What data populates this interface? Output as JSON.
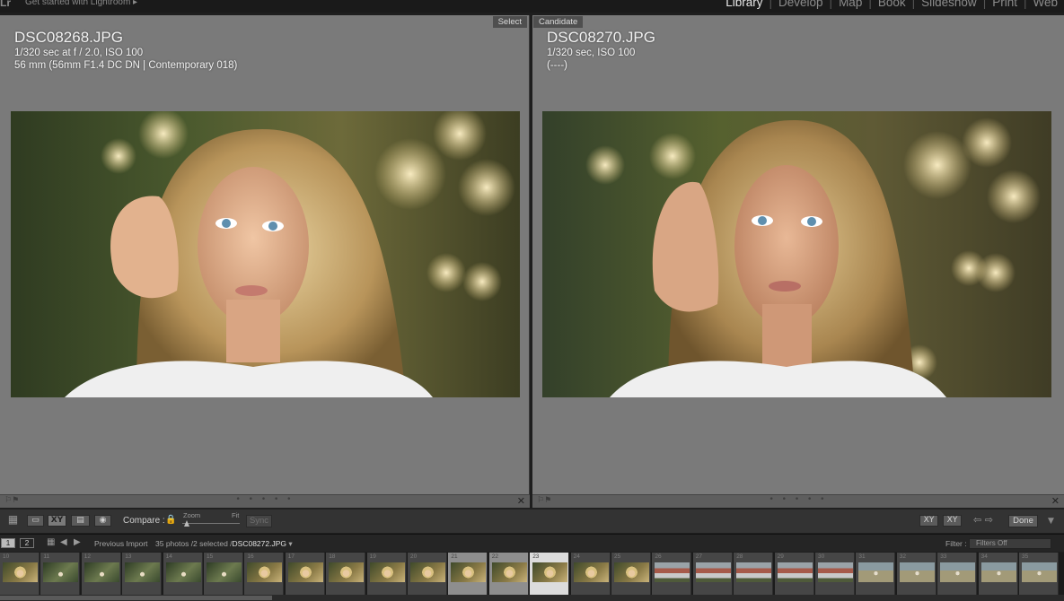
{
  "app": {
    "logo": "Lr",
    "get_started": "Get started with Lightroom  ▸",
    "modules": [
      "Library",
      "Develop",
      "Map",
      "Book",
      "Slideshow",
      "Print",
      "Web"
    ],
    "active_module": "Library"
  },
  "select_pane": {
    "tag": "Select",
    "filename": "DSC08268.JPG",
    "exposure": "1/320 sec at f / 2.0, ISO 100",
    "lens": "56 mm (56mm F1.4 DC DN | Contemporary 018)"
  },
  "candidate_pane": {
    "tag": "Candidate",
    "filename": "DSC08270.JPG",
    "exposure": "1/320 sec, ISO 100",
    "lens": " (----)"
  },
  "pane_footer": {
    "close": "✕",
    "dots": "• • • • •"
  },
  "toolbar": {
    "compare_label": "Compare :",
    "zoom_label": "Zoom",
    "fit_label": "Fit",
    "sync_label": "Sync",
    "done_label": "Done"
  },
  "filmstrip_nav": {
    "screen1": "1",
    "screen2": "2",
    "source": "Previous Import",
    "count": "35 photos /2 selected /",
    "current_file": "DSC08272.JPG",
    "filter_label": "Filter :",
    "filter_value": "Filters Off"
  },
  "filmstrip": {
    "cells": [
      {
        "n": "10",
        "t": "portrait"
      },
      {
        "n": "11",
        "t": "outdoor"
      },
      {
        "n": "12",
        "t": "outdoor"
      },
      {
        "n": "13",
        "t": "outdoor"
      },
      {
        "n": "14",
        "t": "outdoor"
      },
      {
        "n": "15",
        "t": "outdoor"
      },
      {
        "n": "16",
        "t": "portrait"
      },
      {
        "n": "17",
        "t": "portrait"
      },
      {
        "n": "18",
        "t": "portrait"
      },
      {
        "n": "19",
        "t": "portrait"
      },
      {
        "n": "20",
        "t": "portrait"
      },
      {
        "n": "21",
        "t": "portrait",
        "s": "sel"
      },
      {
        "n": "22",
        "t": "portrait",
        "s": "sel"
      },
      {
        "n": "23",
        "t": "portrait",
        "s": "cur"
      },
      {
        "n": "24",
        "t": "portrait"
      },
      {
        "n": "25",
        "t": "portrait"
      },
      {
        "n": "26",
        "t": "house"
      },
      {
        "n": "27",
        "t": "house"
      },
      {
        "n": "28",
        "t": "house"
      },
      {
        "n": "29",
        "t": "house"
      },
      {
        "n": "30",
        "t": "house"
      },
      {
        "n": "31",
        "t": "field"
      },
      {
        "n": "32",
        "t": "field"
      },
      {
        "n": "33",
        "t": "field"
      },
      {
        "n": "34",
        "t": "field"
      },
      {
        "n": "35",
        "t": "field"
      }
    ]
  }
}
